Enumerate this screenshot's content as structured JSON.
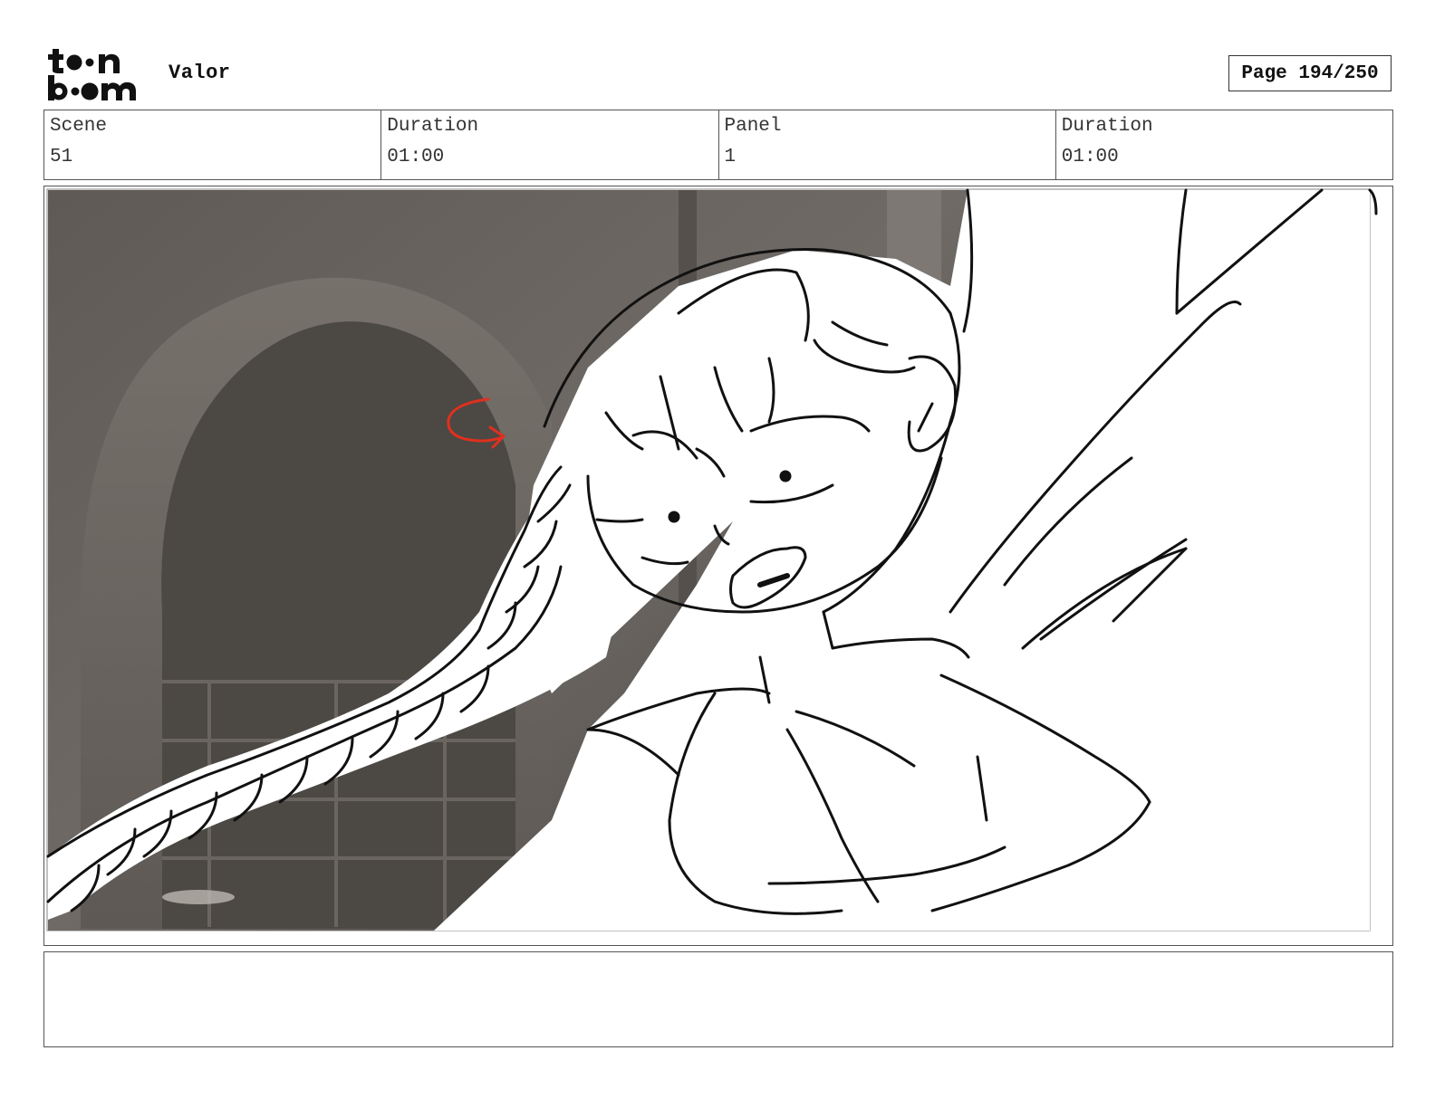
{
  "header": {
    "logo_text_top": "toon",
    "logo_text_bottom": "boom",
    "project_title": "Valor",
    "page_label": "Page 194/250"
  },
  "info": {
    "scene_label": "Scene",
    "scene_value": "51",
    "scene_duration_label": "Duration",
    "scene_duration_value": "01:00",
    "panel_label": "Panel",
    "panel_value": "1",
    "panel_duration_label": "Duration",
    "panel_duration_value": "01:00"
  },
  "panel": {
    "background_color": "#6b6661",
    "sketch_color": "#111111",
    "annotation_color": "#e0301e",
    "annotation_icon": "curved-arrow-icon"
  },
  "notes": {
    "text": ""
  }
}
